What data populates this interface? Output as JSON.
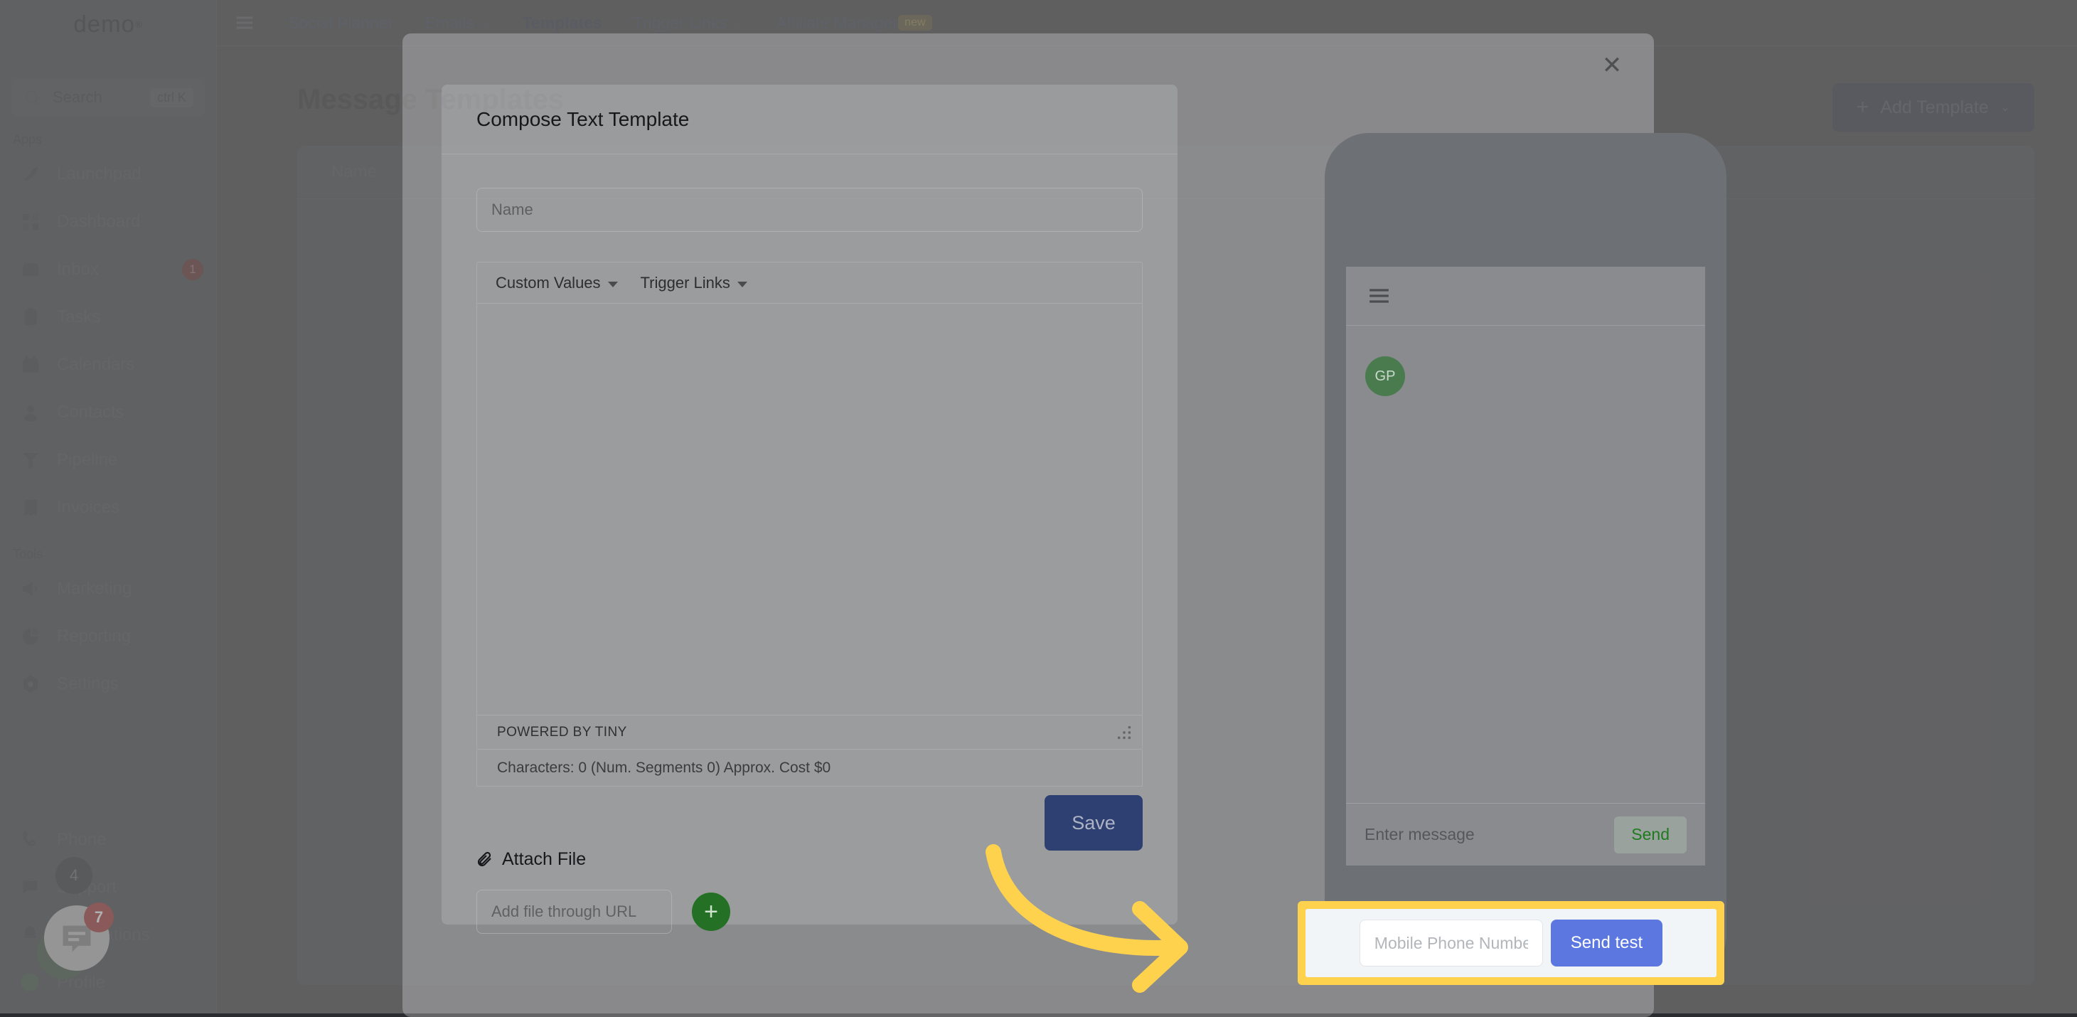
{
  "brand": {
    "name": "demo",
    "mark": "®"
  },
  "sidebar": {
    "search": {
      "label": "Search",
      "shortcut": "ctrl K",
      "icon": "search-icon"
    },
    "groups": [
      {
        "label": "Apps",
        "items": [
          {
            "label": "Launchpad",
            "icon": "rocket-icon",
            "badge": ""
          },
          {
            "label": "Dashboard",
            "icon": "grid-icon",
            "badge": ""
          },
          {
            "label": "Inbox",
            "icon": "inbox-icon",
            "badge": "1"
          },
          {
            "label": "Tasks",
            "icon": "clipboard-check-icon",
            "badge": ""
          },
          {
            "label": "Calendars",
            "icon": "calendar-icon",
            "badge": ""
          },
          {
            "label": "Contacts",
            "icon": "person-icon",
            "badge": ""
          },
          {
            "label": "Pipeline",
            "icon": "funnel-icon",
            "badge": ""
          },
          {
            "label": "Invoices",
            "icon": "receipt-icon",
            "badge": ""
          }
        ]
      },
      {
        "label": "Tools",
        "items": [
          {
            "label": "Marketing",
            "icon": "megaphone-icon",
            "badge": ""
          },
          {
            "label": "Reporting",
            "icon": "pie-chart-icon",
            "badge": ""
          },
          {
            "label": "Settings",
            "icon": "gear-icon",
            "badge": ""
          }
        ]
      }
    ],
    "bottom_items": [
      {
        "label": "Phone",
        "icon": "phone-icon",
        "badge": ""
      },
      {
        "label": "Support",
        "icon": "chat-bubble-icon",
        "badge": ""
      },
      {
        "label": "Notifications",
        "icon": "bell-icon",
        "badge": "4"
      },
      {
        "label": "Profile",
        "icon": "avatar-icon",
        "badge": ""
      }
    ],
    "profile_initials": "GP",
    "chat_widget_badge": "7",
    "notifications_badge": "4"
  },
  "topnav": {
    "menu_icon": "hamburger-icon",
    "items": [
      {
        "label": "Social Planner",
        "has_caret": false,
        "active": false,
        "badge": ""
      },
      {
        "label": "Emails",
        "has_caret": true,
        "active": false,
        "badge": ""
      },
      {
        "label": "Templates",
        "has_caret": false,
        "active": true,
        "badge": ""
      },
      {
        "label": "Trigger Links",
        "has_caret": true,
        "active": false,
        "badge": ""
      },
      {
        "label": "Affiliate Manager",
        "has_caret": true,
        "active": false,
        "badge": "new"
      }
    ]
  },
  "page": {
    "title": "Message Templates",
    "add_button_label": "Add Template",
    "add_button_plus": "+",
    "add_button_caret": "⌄",
    "table_columns": [
      "Name"
    ]
  },
  "modal": {
    "title": "Compose Text Template",
    "close_icon": "close-icon",
    "name_placeholder": "Name",
    "name_value": "",
    "editor": {
      "toolbar": [
        {
          "label": "Custom Values",
          "icon": "chevron-down-icon"
        },
        {
          "label": "Trigger Links",
          "icon": "chevron-down-icon"
        }
      ],
      "content": "",
      "status_bar": "POWERED BY TINY",
      "resize_handle_icon": "resize-grip-icon",
      "char_count": "Characters: 0 (Num. Segments 0) Approx. Cost $0"
    },
    "attach": {
      "label": "Attach File",
      "icon": "paperclip-icon",
      "url_placeholder": "Add file through URL",
      "url_value": "",
      "add_button_glyph": "+"
    },
    "save_label": "Save",
    "preview": {
      "menu_icon": "hamburger-icon",
      "avatar_initials": "GP",
      "message_placeholder": "Enter message",
      "message_value": "",
      "send_label": "Send"
    },
    "test": {
      "phone_placeholder": "Mobile Phone Number",
      "phone_value": "",
      "send_test_label": "Send test",
      "highlight_color": "#ffd24d"
    }
  },
  "annotation": {
    "arrow_icon": "curved-arrow-right-icon",
    "arrow_color": "#ffd24d"
  },
  "colors": {
    "accent_blue": "#5c77e0",
    "save_blue": "#2e3f72",
    "green": "#247024",
    "highlight_yellow": "#ffd24d",
    "badge_red": "#9b1c1c"
  }
}
